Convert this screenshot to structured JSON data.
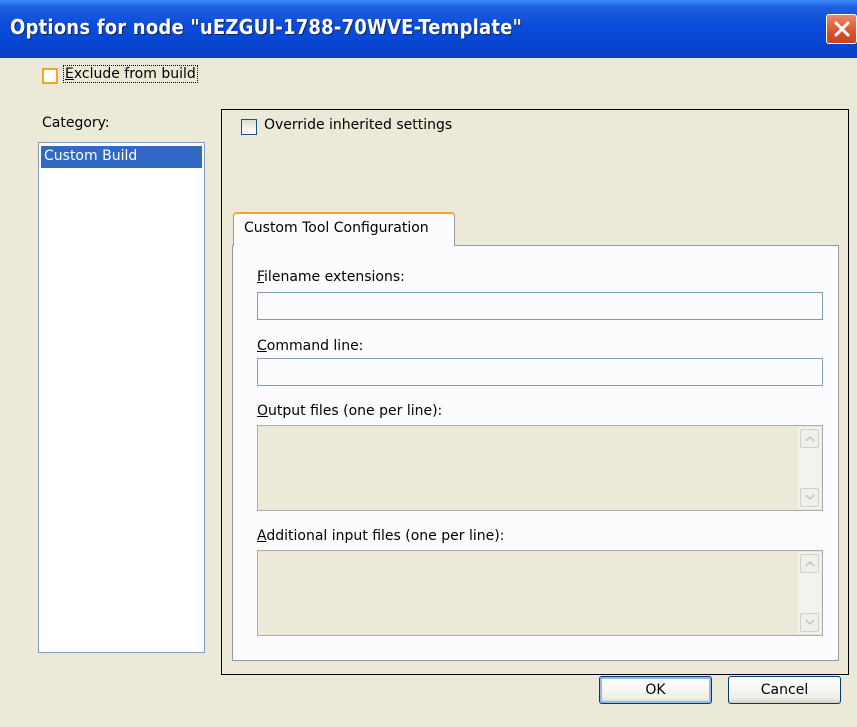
{
  "window": {
    "title": "Options for node \"uEZGUI-1788-70WVE-Template\""
  },
  "exclude_from_build": {
    "label_underline": "E",
    "label_rest": "xclude from build",
    "checked": false
  },
  "category": {
    "label": "Category:",
    "items": [
      {
        "label": "Custom Build",
        "selected": true
      }
    ]
  },
  "override": {
    "label": "Override inherited settings",
    "checked": false
  },
  "tab": {
    "label": "Custom Tool Configuration"
  },
  "fields": {
    "filename_extensions": {
      "label_underline": "F",
      "label_rest": "ilename extensions:",
      "value": ""
    },
    "command_line": {
      "label_underline": "C",
      "label_rest": "ommand line:",
      "value": ""
    },
    "output_files": {
      "label_underline": "O",
      "label_rest": "utput files (one per line):",
      "value": ""
    },
    "additional_inputs": {
      "label_underline": "A",
      "label_rest": "dditional input files (one per line):",
      "value": ""
    }
  },
  "buttons": {
    "ok": "OK",
    "cancel": "Cancel"
  },
  "colors": {
    "title_bar": "#0a4bd8",
    "selection": "#316ac5",
    "focus_accent": "#f5a623",
    "dialog_bg": "#ece9d8"
  }
}
